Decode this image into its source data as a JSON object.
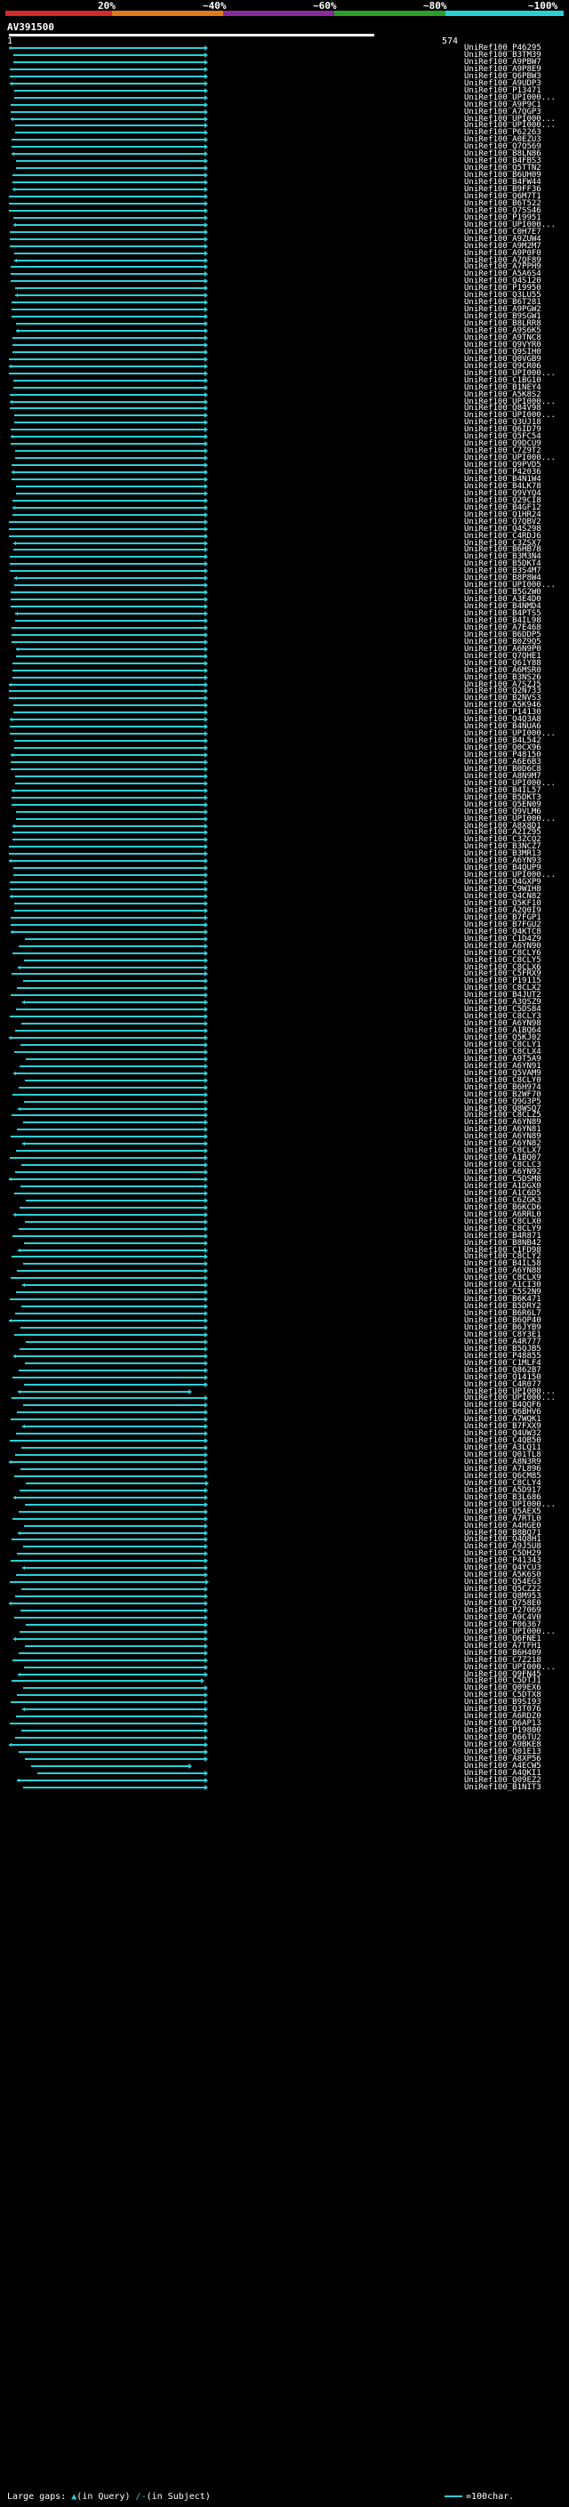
{
  "legend": {
    "labels": [
      "20%",
      "~40%",
      "~60%",
      "~80%",
      "~100%"
    ],
    "colors": [
      "#d42a2a",
      "#e07a1a",
      "#8a2aa0",
      "#2aa02a",
      "#2ad0d8"
    ]
  },
  "query": {
    "id": "AV391500",
    "start": "1",
    "end": "574"
  },
  "hits": [
    "UniRef100_P46295",
    "UniRef100_B3TM39",
    "UniRef100_A9PBW7",
    "UniRef100_A9P8E9",
    "UniRef100_Q6PBW3",
    "UniRef100_A9UDP3",
    "UniRef100_P13471",
    "UniRef100_UPI000...",
    "UniRef100_A9P9C1",
    "UniRef100_A7QGP3",
    "UniRef100_UPI000...",
    "UniRef100_UPI000...",
    "UniRef100_P62263",
    "UniRef100_A0EZU3",
    "UniRef100_Q7Q569",
    "UniRef100_B8LN86",
    "UniRef100_B4FBS3",
    "UniRef100_Q5TTN2",
    "UniRef100_B6UH09",
    "UniRef100_B4FW44",
    "UniRef100_B9FF36",
    "UniRef100_Q6M7T1",
    "UniRef100_B6T522",
    "UniRef100_Q7SS46",
    "UniRef100_P19951",
    "UniRef100_UPI000...",
    "UniRef100_C0H7E7",
    "UniRef100_A9ZUW4",
    "UniRef100_A9M2M7",
    "UniRef100_A9P0F0",
    "UniRef100_A7QF89",
    "UniRef100_A7PPH9",
    "UniRef100_A5A6S4",
    "UniRef100_Q4S120",
    "UniRef100_P19950",
    "UniRef100_Q3LU55",
    "UniRef100_B6T281",
    "UniRef100_A9PGW2",
    "UniRef100_B9SGW1",
    "UniRef100_B8LRR8",
    "UniRef100_A9S6K5",
    "UniRef100_A9TNC8",
    "UniRef100_Q9VYR0",
    "UniRef100_Q9SIH0",
    "UniRef100_Q0VGB9",
    "UniRef100_Q9CR06",
    "UniRef100_UPI000...",
    "UniRef100_C1BG10",
    "UniRef100_B1NEY4",
    "UniRef100_A5K8S2",
    "UniRef100_UPI000...",
    "UniRef100_Q84V98",
    "UniRef100_UPI000...",
    "UniRef100_Q3UJ18",
    "UniRef100_Q6ID79",
    "UniRef100_Q5FC54",
    "UniRef100_Q9DCU9",
    "UniRef100_C7Z9T2",
    "UniRef100_UPI000...",
    "UniRef100_Q9PVD5",
    "UniRef100_P42036",
    "UniRef100_B4N1W4",
    "UniRef100_B4LK78",
    "UniRef100_Q9VYQ4",
    "UniRef100_Q29CI8",
    "UniRef100_B4GF12",
    "UniRef100_Q1HR24",
    "UniRef100_Q7QBV2",
    "UniRef100_Q4S298",
    "UniRef100_C4RDJ6",
    "UniRef100_C3ZSX7",
    "UniRef100_B6HB78",
    "UniRef100_B3M3N4",
    "UniRef100_B5DKT4",
    "UniRef100_B3S4M7",
    "UniRef100_B8P8W4",
    "UniRef100_UPI000...",
    "UniRef100_B5G2W0",
    "UniRef100_A3E4D0",
    "UniRef100_B4NMD4",
    "UniRef100_B4PTS5",
    "UniRef100_B4IL98",
    "UniRef100_A7E468",
    "UniRef100_B6DDP5",
    "UniRef100_B0Z9Q5",
    "UniRef100_A6N9P0",
    "UniRef100_Q7QHE1",
    "UniRef100_Q61Y88",
    "UniRef100_A6MSR0",
    "UniRef100_B3NS26",
    "UniRef100_A7SZJ5",
    "UniRef100_Q2N733",
    "UniRef100_B2NVS3",
    "UniRef100_A5K946",
    "UniRef100_P14130",
    "UniRef100_Q4Q3A8",
    "UniRef100_B4NUA6",
    "UniRef100_UPI000...",
    "UniRef100_B4L542",
    "UniRef100_Q0CX96",
    "UniRef100_P48150",
    "UniRef100_A6E6B3",
    "UniRef100_B0D6C8",
    "UniRef100_A8N9M7",
    "UniRef100_UPI000...",
    "UniRef100_B4IL57",
    "UniRef100_B5DKT3",
    "UniRef100_Q5EN09",
    "UniRef100_Q9VLM6",
    "UniRef100_UPI000...",
    "UniRef100_A8X8D1",
    "UniRef100_A2IZ95",
    "UniRef100_C3ZCQ2",
    "UniRef100_B3NCZ7",
    "UniRef100_B3MR13",
    "UniRef100_A6YN93",
    "UniRef100_B4QUP9",
    "UniRef100_UPI000...",
    "UniRef100_Q4GXP9",
    "UniRef100_C9WIH8",
    "UniRef100_Q4CN82",
    "UniRef100_Q5KF10",
    "UniRef100_A2Q0I9",
    "UniRef100_B7FGP1",
    "UniRef100_B7FGU2",
    "UniRef100_Q4KTC8",
    "UniRef100_C1D4Z9",
    "UniRef100_A6YN90",
    "UniRef100_C8CLY6",
    "UniRef100_C8CLY5",
    "UniRef100_C8CLX6",
    "UniRef100_C5FRX9",
    "UniRef100_P19115",
    "UniRef100_C8CLX2",
    "UniRef100_B4JUT2",
    "UniRef100_A3QSZ9",
    "UniRef100_C5DS84",
    "UniRef100_C8CLY3",
    "UniRef100_A6YN98",
    "UniRef100_A1BQ64",
    "UniRef100_Q5KJ02",
    "UniRef100_C8CLY1",
    "UniRef100_C8CLX4",
    "UniRef100_A9T5A9",
    "UniRef100_A6YN91",
    "UniRef100_Q5VAM9",
    "UniRef100_C8CLY0",
    "UniRef100_B6H974",
    "UniRef100_B2WF70",
    "UniRef100_Q9G3P5",
    "UniRef100_Q8WSQ7",
    "UniRef100_C8CLZ5",
    "UniRef100_A6YN89",
    "UniRef100_A6YN81",
    "UniRef100_A6YN89",
    "UniRef100_A6YN82",
    "UniRef100_C8CLX7",
    "UniRef100_A1BQ07",
    "UniRef100_C8CLC3",
    "UniRef100_A6YN92",
    "UniRef100_C5DSM8",
    "UniRef100_A1DGX0",
    "UniRef100_A1C6D5",
    "UniRef100_C6ZGK3",
    "UniRef100_B6KCD6",
    "UniRef100_A6RRL0",
    "UniRef100_C8CLX0",
    "UniRef100_C8CLY9",
    "UniRef100_B4R871",
    "UniRef100_B8NB42",
    "UniRef100_C1FD98",
    "UniRef100_C8CLY2",
    "UniRef100_B4IL58",
    "UniRef100_A6YN88",
    "UniRef100_C8CLX9",
    "UniRef100_A1CI30",
    "UniRef100_C5S2N9",
    "UniRef100_B6K471",
    "UniRef100_B5DRY2",
    "UniRef100_B6R6L7",
    "UniRef100_B6QP40",
    "UniRef100_B6JYB9",
    "UniRef100_C8Y3E1",
    "UniRef100_A4R777",
    "UniRef100_B5QJB5",
    "UniRef100_P48855",
    "UniRef100_C1MLF4",
    "UniRef100_Q862B7",
    "UniRef100_Q14150",
    "UniRef100_C4R077",
    "UniRef100_UPI000...",
    "UniRef100_UPI000...",
    "UniRef100_B4QQF6",
    "UniRef100_Q6BHV6",
    "UniRef100_A7WQK1",
    "UniRef100_B7FXX9",
    "UniRef100_Q4UW32",
    "UniRef100_C4QB50",
    "UniRef100_A3LQ11",
    "UniRef100_Q01TL8",
    "UniRef100_A8N3R9",
    "UniRef100_A7L896",
    "UniRef100_Q6CM85",
    "UniRef100_C8CLY4",
    "UniRef100_A5D917",
    "UniRef100_B3L686",
    "UniRef100_UPI000...",
    "UniRef100_Q5AEX5",
    "UniRef100_A7RTL0",
    "UniRef100_A4HGE0",
    "UniRef100_B8BQ71",
    "UniRef100_Q4Q8H1",
    "UniRef100_A9J5U8",
    "UniRef100_C5DH29",
    "UniRef100_P41343",
    "UniRef100_Q4YCU3",
    "UniRef100_A5K6S0",
    "UniRef100_Q54EG3",
    "UniRef100_Q5CZ22",
    "UniRef100_Q8M953",
    "UniRef100_Q758E0",
    "UniRef100_P27069",
    "UniRef100_A9C4V0",
    "UniRef100_P06367",
    "UniRef100_UPI000...",
    "UniRef100_Q6FNE1",
    "UniRef100_A7TFH1",
    "UniRef100_B6H409",
    "UniRef100_C7Z218",
    "UniRef100_UPI000...",
    "UniRef100_Q9FN45",
    "UniRef100_C5DTJ1",
    "UniRef100_Q09EX6",
    "UniRef100_C5DTX8",
    "UniRef100_B9SI93",
    "UniRef100_Q3T076",
    "UniRef100_A6RDZ0",
    "UniRef100_Q6AP13",
    "UniRef100_P19800",
    "UniRef100_Q66TU2",
    "UniRef100_A9BKE8",
    "UniRef100_Q01E13",
    "UniRef100_A8XP56",
    "UniRef100_A4ECW5",
    "UniRef100_A4QKI1",
    "UniRef100_Q09EZ2",
    "UniRef100_B1NIT3"
  ],
  "footer": {
    "large_gaps_label": "Large gaps:",
    "gap_query_symbol": "▲",
    "gap_query_text": "(in Query)",
    "gap_subject_symbol": "/-",
    "gap_subject_text": "(in Subject)",
    "scale_text": "=100char."
  }
}
